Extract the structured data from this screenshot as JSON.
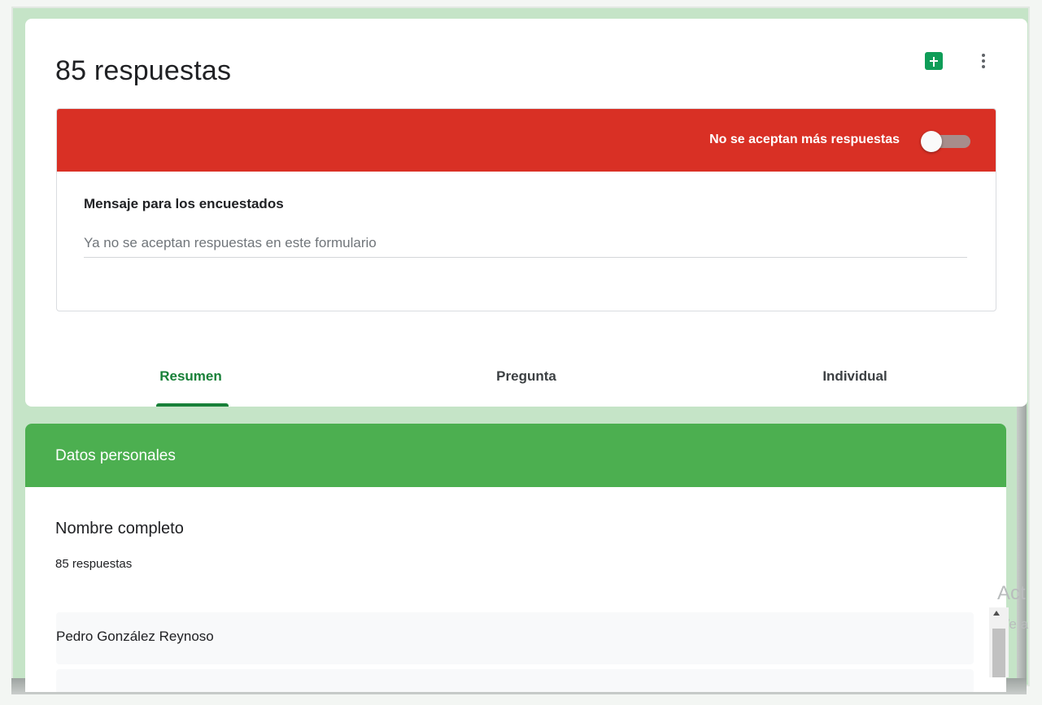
{
  "summary": {
    "title": "85 respuestas",
    "sheets_icon": "sheets-icon",
    "more_icon": "more-vert-icon"
  },
  "accepting": {
    "label": "No se aceptan más respuestas",
    "toggle_on": false,
    "bar_color": "#d93025",
    "message_label": "Mensaje para los encuestados",
    "message_placeholder": "Ya no se aceptan respuestas en este formulario"
  },
  "tabs": [
    {
      "label": "Resumen",
      "active": true
    },
    {
      "label": "Pregunta",
      "active": false
    },
    {
      "label": "Individual",
      "active": false
    }
  ],
  "section": {
    "title": "Datos personales",
    "header_color": "#4caf50",
    "question": "Nombre completo",
    "response_count": "85 respuestas",
    "responses": [
      "Pedro González Reynoso"
    ]
  },
  "watermark": {
    "line1": "Act",
    "line2": "Ve a"
  }
}
